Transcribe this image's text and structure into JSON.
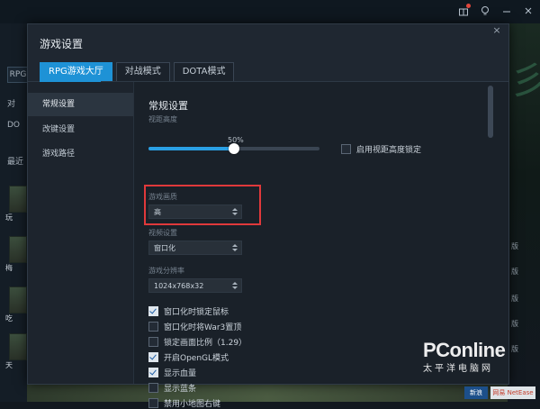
{
  "dialog": {
    "title": "游戏设置",
    "close_glyph": "×",
    "tabs": [
      {
        "label": "RPG游戏大厅",
        "active": true
      },
      {
        "label": "对战模式",
        "active": false
      },
      {
        "label": "DOTA模式",
        "active": false
      }
    ],
    "sidebar": [
      {
        "label": "常规设置",
        "active": true
      },
      {
        "label": "改键设置",
        "active": false
      },
      {
        "label": "游戏路径",
        "active": false
      }
    ],
    "section_title": "常规设置",
    "view_height": {
      "label": "视距高度",
      "value_text": "50%",
      "value": 0.5,
      "lock_label": "启用视距高度锁定",
      "lock_checked": false
    },
    "quality": {
      "label": "游戏画质",
      "value": "高"
    },
    "display_mode": {
      "label": "视频设置",
      "value": "窗口化"
    },
    "resolution": {
      "label": "游戏分辨率",
      "value": "1024x768x32"
    },
    "options": [
      {
        "label": "窗口化时锁定鼠标",
        "checked": true
      },
      {
        "label": "窗口化时将War3置顶",
        "checked": false
      },
      {
        "label": "锁定画面比例（1.29）",
        "checked": false
      },
      {
        "label": "开启OpenGL模式",
        "checked": true
      },
      {
        "label": "显示血量",
        "checked": true
      },
      {
        "label": "显示蓝条",
        "checked": false
      },
      {
        "label": "禁用小地图右键",
        "checked": false
      }
    ]
  },
  "background": {
    "left_tabs": [
      "RPG",
      "对",
      "DO",
      "最近"
    ],
    "left_thumb_labels": [
      "玩",
      "梅",
      "吃",
      "天"
    ],
    "right_labels": [
      "版",
      "版",
      "版",
      "版",
      "版"
    ],
    "watermark": {
      "brand": "PConline",
      "sub": "太平洋电脑网"
    },
    "logos": [
      "新浪",
      "网易 NetEase"
    ]
  },
  "colors": {
    "accent": "#1e92d6",
    "highlight": "#e0393b",
    "dialog_bg": "#1f2731"
  },
  "icons": [
    "gift-icon",
    "bulb-icon",
    "minimize-icon",
    "close-icon",
    "chevron-updown-icon",
    "checkbox-icon"
  ]
}
